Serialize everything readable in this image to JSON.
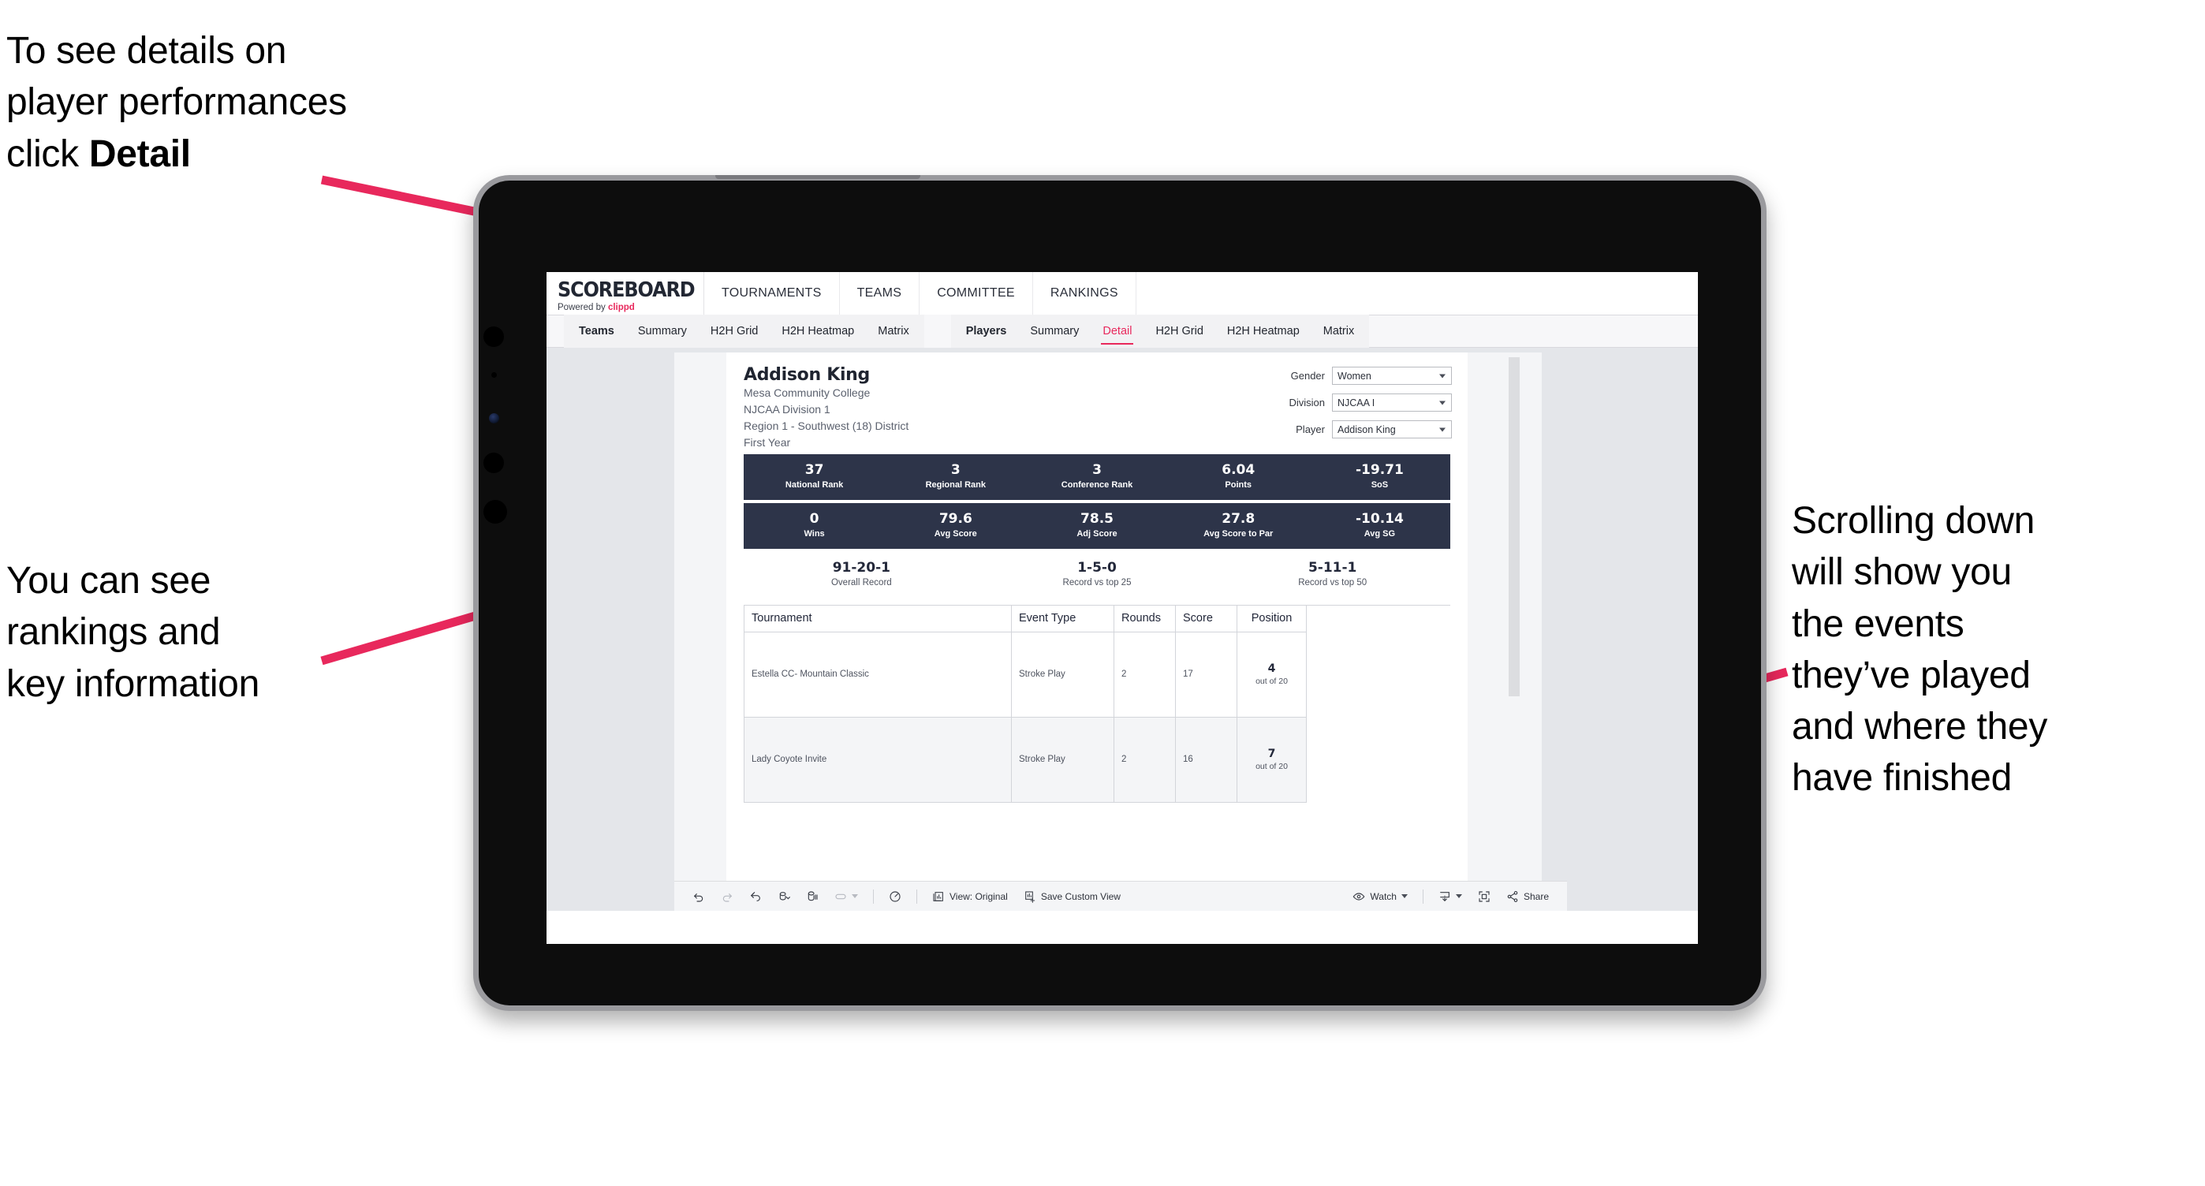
{
  "annotations": [
    {
      "id": "detail",
      "text_before": "To see details on\nplayer performances\nclick ",
      "bold": "Detail",
      "text_after": ""
    },
    {
      "id": "rankings",
      "text": "You can see\nrankings and\nkey information"
    },
    {
      "id": "scroll",
      "text": "Scrolling down\nwill show you\nthe events\nthey’ve played\nand where they\nhave finished"
    }
  ],
  "colors": {
    "accent_pink": "#e8285c",
    "arrow_pink": "#e8285c",
    "stat_bar_navy": "#2d3449",
    "canvas_gray": "#e4e6ea",
    "bezel_black": "#0d0d0d",
    "frame_silver": "#9a9a9e"
  },
  "app": {
    "logo": {
      "word": "SCOREBOARD",
      "powered_prefix": "Powered by ",
      "brand": "clippd"
    },
    "main_nav": [
      "TOURNAMENTS",
      "TEAMS",
      "COMMITTEE",
      "RANKINGS"
    ],
    "sub_tabs_left": [
      "Teams",
      "Summary",
      "H2H Grid",
      "H2H Heatmap",
      "Matrix"
    ],
    "sub_tabs_right": [
      "Players",
      "Summary",
      "Detail",
      "H2H Grid",
      "H2H Heatmap",
      "Matrix"
    ],
    "active_tab": "Detail"
  },
  "player": {
    "name": "Addison King",
    "school": "Mesa Community College",
    "division": "NJCAA Division 1",
    "region": "Region 1 - Southwest (18) District",
    "class_year": "First Year"
  },
  "filters": [
    {
      "label": "Gender",
      "value": "Women"
    },
    {
      "label": "Division",
      "value": "NJCAA I"
    },
    {
      "label": "Player",
      "value": "Addison King"
    }
  ],
  "stats_row1": [
    {
      "value": "37",
      "label": "National Rank"
    },
    {
      "value": "3",
      "label": "Regional Rank"
    },
    {
      "value": "3",
      "label": "Conference Rank"
    },
    {
      "value": "6.04",
      "label": "Points"
    },
    {
      "value": "-19.71",
      "label": "SoS"
    }
  ],
  "stats_row2": [
    {
      "value": "0",
      "label": "Wins"
    },
    {
      "value": "79.6",
      "label": "Avg Score"
    },
    {
      "value": "78.5",
      "label": "Adj Score"
    },
    {
      "value": "27.8",
      "label": "Avg Score to Par"
    },
    {
      "value": "-10.14",
      "label": "Avg SG"
    }
  ],
  "records": [
    {
      "value": "91-20-1",
      "label": "Overall Record"
    },
    {
      "value": "1-5-0",
      "label": "Record vs top 25"
    },
    {
      "value": "5-11-1",
      "label": "Record vs top 50"
    }
  ],
  "events_table": {
    "columns": [
      "Tournament",
      "Event Type",
      "Rounds",
      "Score",
      "Position"
    ],
    "rows": [
      {
        "tournament": "Estella CC- Mountain Classic",
        "event_type": "Stroke Play",
        "rounds": "2",
        "score": "17",
        "position_value": "4",
        "position_label": "out of 20"
      },
      {
        "tournament": "Lady Coyote Invite",
        "event_type": "Stroke Play",
        "rounds": "2",
        "score": "16",
        "position_value": "7",
        "position_label": "out of 20"
      }
    ]
  },
  "toolbar": {
    "view_label": "View: Original",
    "save_label": "Save Custom View",
    "watch_label": "Watch",
    "share_label": "Share"
  }
}
